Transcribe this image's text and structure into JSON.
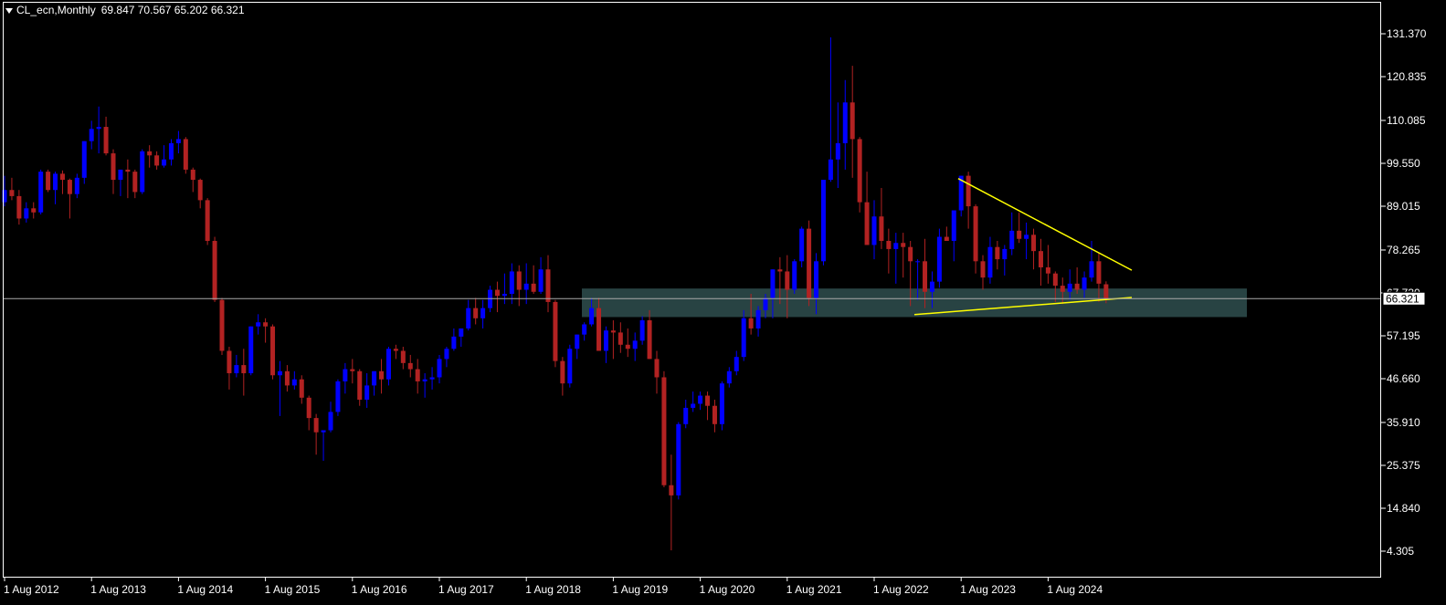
{
  "header": {
    "symbol": "CL_ecn,Monthly",
    "ohlc": "69.847 70.567 65.202 66.321"
  },
  "colors": {
    "background": "#000000",
    "axis": "#ffffff",
    "bull": "#0000ff",
    "bear": "#b22222",
    "wick": "#a0a0a0",
    "zone": "#2f4f4f",
    "trendline": "#ffff00",
    "price_line": "#a9a9a9"
  },
  "chart_data": {
    "type": "candlestick",
    "x_ticks": [
      "1 Aug 2012",
      "1 Aug 2013",
      "1 Aug 2014",
      "1 Aug 2015",
      "1 Aug 2016",
      "1 Aug 2017",
      "1 Aug 2018",
      "1 Aug 2019",
      "1 Aug 2020",
      "1 Aug 2021",
      "1 Aug 2022",
      "1 Aug 2023",
      "1 Aug 2024"
    ],
    "y_ticks": [
      "131.370",
      "120.835",
      "110.085",
      "99.550",
      "89.015",
      "78.265",
      "67.730",
      "57.195",
      "46.660",
      "35.910",
      "25.375",
      "14.840",
      "4.305"
    ],
    "ylim": [
      0.5,
      137.6
    ],
    "current_price": "66.321",
    "start": "2012-02",
    "months_per_x_tick": 12,
    "candles": [
      [
        92.7,
        100.5,
        89.0,
        96.0
      ],
      [
        96.0,
        96.5,
        86.5,
        88.2
      ],
      [
        88.2,
        92.0,
        84.5,
        90.5
      ],
      [
        90.5,
        91.2,
        85.0,
        86.3
      ],
      [
        86.3,
        87.0,
        80.5,
        82.5
      ],
      [
        82.5,
        91.0,
        81.5,
        90.0
      ],
      [
        90.0,
        96.5,
        89.0,
        93.0
      ],
      [
        93.0,
        96.0,
        90.5,
        91.5
      ],
      [
        91.5,
        93.0,
        84.5,
        86.0
      ],
      [
        86.0,
        90.0,
        85.0,
        88.5
      ],
      [
        88.5,
        90.0,
        86.0,
        87.5
      ],
      [
        87.5,
        98.0,
        87.0,
        97.5
      ],
      [
        97.5,
        98.0,
        92.5,
        93.0
      ],
      [
        93.0,
        97.5,
        89.5,
        97.0
      ],
      [
        97.0,
        97.8,
        92.0,
        95.5
      ],
      [
        95.5,
        95.8,
        86.0,
        92.0
      ],
      [
        92.0,
        97.0,
        91.0,
        96.0
      ],
      [
        96.0,
        103.5,
        94.5,
        105.0
      ],
      [
        105.0,
        110.0,
        103.0,
        108.0
      ],
      [
        108.0,
        113.5,
        102.0,
        108.5
      ],
      [
        108.5,
        111.0,
        101.5,
        102.0
      ],
      [
        102.0,
        103.0,
        92.0,
        95.5
      ],
      [
        95.5,
        98.0,
        91.5,
        98.0
      ],
      [
        98.0,
        100.5,
        91.0,
        97.5
      ],
      [
        97.5,
        98.0,
        91.0,
        92.5
      ],
      [
        92.5,
        103.0,
        92.0,
        102.5
      ],
      [
        102.5,
        104.0,
        98.5,
        101.5
      ],
      [
        101.5,
        102.5,
        98.0,
        99.0
      ],
      [
        99.0,
        104.0,
        98.5,
        100.5
      ],
      [
        100.5,
        105.5,
        99.0,
        104.5
      ],
      [
        104.5,
        107.5,
        102.0,
        105.5
      ],
      [
        105.5,
        106.0,
        97.0,
        98.0
      ],
      [
        98.0,
        98.5,
        92.5,
        95.5
      ],
      [
        95.5,
        95.8,
        88.5,
        90.5
      ],
      [
        90.5,
        91.0,
        79.5,
        80.5
      ],
      [
        80.5,
        81.5,
        65.5,
        66.0
      ],
      [
        66.0,
        66.5,
        52.5,
        53.5
      ],
      [
        53.5,
        54.5,
        44.0,
        48.0
      ],
      [
        48.0,
        52.5,
        47.0,
        50.0
      ],
      [
        50.0,
        54.0,
        42.5,
        48.0
      ],
      [
        48.0,
        59.5,
        47.5,
        59.5
      ],
      [
        59.5,
        62.5,
        57.5,
        60.5
      ],
      [
        60.5,
        61.5,
        55.5,
        59.5
      ],
      [
        59.5,
        60.0,
        46.5,
        47.5
      ],
      [
        47.5,
        51.0,
        37.5,
        48.5
      ],
      [
        48.5,
        50.0,
        43.5,
        45.0
      ],
      [
        45.0,
        48.5,
        44.0,
        46.5
      ],
      [
        46.5,
        47.5,
        40.5,
        42.0
      ],
      [
        42.0,
        42.5,
        34.0,
        37.0
      ],
      [
        37.0,
        38.0,
        28.0,
        33.5
      ],
      [
        33.5,
        34.0,
        26.5,
        34.0
      ],
      [
        34.0,
        41.0,
        33.5,
        38.5
      ],
      [
        38.5,
        46.5,
        37.5,
        46.0
      ],
      [
        46.0,
        50.5,
        43.0,
        49.0
      ],
      [
        49.0,
        51.5,
        45.5,
        48.5
      ],
      [
        48.5,
        49.0,
        40.0,
        41.5
      ],
      [
        41.5,
        48.0,
        39.5,
        45.0
      ],
      [
        45.0,
        48.5,
        42.5,
        48.5
      ],
      [
        48.5,
        51.5,
        43.0,
        46.5
      ],
      [
        46.5,
        54.5,
        45.0,
        54.0
      ],
      [
        54.0,
        55.0,
        51.5,
        53.5
      ],
      [
        53.5,
        54.5,
        49.0,
        50.5
      ],
      [
        50.5,
        52.5,
        47.0,
        49.0
      ],
      [
        49.0,
        51.5,
        43.0,
        46.0
      ],
      [
        46.0,
        48.0,
        42.0,
        46.5
      ],
      [
        46.5,
        49.5,
        44.0,
        47.0
      ],
      [
        47.0,
        52.5,
        45.5,
        51.5
      ],
      [
        51.5,
        54.5,
        49.5,
        54.0
      ],
      [
        54.0,
        59.0,
        53.5,
        57.0
      ],
      [
        57.0,
        59.0,
        54.5,
        59.0
      ],
      [
        59.0,
        66.0,
        58.5,
        64.0
      ],
      [
        64.0,
        66.5,
        60.0,
        61.5
      ],
      [
        61.5,
        66.0,
        59.0,
        64.0
      ],
      [
        64.0,
        69.5,
        63.0,
        68.5
      ],
      [
        68.5,
        70.5,
        63.0,
        67.0
      ],
      [
        67.0,
        72.5,
        65.0,
        67.5
      ],
      [
        67.5,
        75.0,
        65.0,
        73.0
      ],
      [
        73.0,
        74.5,
        64.5,
        68.5
      ],
      [
        68.5,
        75.0,
        65.0,
        70.0
      ],
      [
        70.0,
        74.5,
        67.5,
        68.0
      ],
      [
        68.0,
        76.5,
        67.5,
        73.5
      ],
      [
        73.5,
        77.0,
        63.0,
        65.5
      ],
      [
        65.5,
        66.0,
        49.5,
        51.0
      ],
      [
        51.0,
        52.0,
        42.5,
        45.5
      ],
      [
        45.5,
        55.0,
        44.5,
        54.0
      ],
      [
        54.0,
        57.5,
        51.5,
        57.5
      ],
      [
        57.5,
        60.5,
        56.0,
        60.0
      ],
      [
        60.0,
        66.5,
        59.5,
        64.0
      ],
      [
        64.0,
        66.5,
        56.0,
        53.5
      ],
      [
        53.5,
        59.5,
        50.5,
        58.5
      ],
      [
        58.5,
        61.0,
        51.5,
        58.0
      ],
      [
        58.0,
        60.5,
        53.0,
        55.0
      ],
      [
        55.0,
        59.0,
        52.0,
        54.0
      ],
      [
        54.0,
        58.0,
        51.0,
        56.0
      ],
      [
        56.0,
        62.0,
        55.0,
        61.0
      ],
      [
        61.0,
        63.5,
        57.0,
        51.5
      ],
      [
        51.5,
        53.5,
        43.0,
        47.0
      ],
      [
        47.0,
        48.5,
        20.0,
        20.5
      ],
      [
        20.5,
        28.0,
        4.5,
        18.0
      ],
      [
        18.0,
        36.0,
        17.0,
        35.5
      ],
      [
        35.5,
        41.5,
        34.5,
        39.5
      ],
      [
        39.5,
        43.5,
        38.5,
        40.5
      ],
      [
        40.5,
        43.5,
        39.0,
        42.5
      ],
      [
        42.5,
        43.5,
        36.5,
        40.0
      ],
      [
        40.0,
        41.5,
        33.5,
        35.5
      ],
      [
        35.5,
        46.0,
        34.0,
        45.5
      ],
      [
        45.5,
        49.5,
        44.5,
        48.5
      ],
      [
        48.5,
        53.5,
        47.5,
        52.0
      ],
      [
        52.0,
        63.5,
        51.0,
        61.5
      ],
      [
        61.5,
        67.5,
        57.5,
        59.0
      ],
      [
        59.0,
        64.5,
        57.0,
        63.5
      ],
      [
        63.5,
        67.5,
        61.5,
        66.5
      ],
      [
        66.5,
        70.5,
        61.5,
        73.5
      ],
      [
        73.5,
        76.5,
        65.0,
        73.0
      ],
      [
        73.0,
        77.0,
        61.5,
        68.5
      ],
      [
        68.5,
        76.0,
        67.5,
        75.5
      ],
      [
        75.5,
        84.0,
        74.0,
        83.5
      ],
      [
        83.5,
        85.5,
        64.5,
        66.5
      ],
      [
        66.5,
        77.5,
        62.5,
        75.5
      ],
      [
        75.5,
        91.5,
        74.5,
        95.5
      ],
      [
        95.5,
        130.5,
        95.0,
        100.5
      ],
      [
        100.5,
        114.5,
        93.5,
        104.5
      ],
      [
        104.5,
        120.0,
        98.0,
        114.5
      ],
      [
        114.5,
        123.5,
        96.0,
        105.5
      ],
      [
        105.5,
        106.0,
        87.5,
        90.0
      ],
      [
        90.0,
        97.5,
        81.5,
        79.5
      ],
      [
        79.5,
        90.5,
        76.0,
        86.5
      ],
      [
        86.5,
        93.5,
        78.5,
        80.5
      ],
      [
        80.5,
        83.5,
        72.5,
        78.5
      ],
      [
        78.5,
        82.5,
        70.0,
        80.0
      ],
      [
        80.0,
        82.5,
        71.5,
        79.0
      ],
      [
        79.0,
        80.5,
        64.5,
        75.5
      ],
      [
        75.5,
        76.0,
        66.0,
        75.5
      ],
      [
        75.5,
        81.0,
        64.0,
        68.0
      ],
      [
        68.0,
        73.0,
        64.0,
        70.5
      ],
      [
        70.5,
        83.5,
        69.0,
        81.5
      ],
      [
        81.5,
        84.0,
        80.5,
        80.5
      ],
      [
        80.5,
        84.5,
        75.5,
        88.0
      ],
      [
        88.0,
        95.0,
        86.5,
        96.5
      ],
      [
        96.5,
        97.5,
        83.5,
        89.0
      ],
      [
        89.0,
        89.5,
        72.5,
        75.5
      ],
      [
        75.5,
        77.0,
        68.5,
        71.5
      ],
      [
        71.5,
        81.5,
        70.0,
        79.0
      ],
      [
        79.0,
        80.5,
        73.5,
        76.0
      ],
      [
        76.0,
        79.5,
        72.0,
        78.5
      ],
      [
        78.5,
        87.5,
        77.0,
        83.0
      ],
      [
        83.0,
        87.5,
        80.0,
        81.0
      ],
      [
        81.0,
        85.0,
        76.0,
        82.0
      ],
      [
        82.0,
        83.5,
        73.5,
        78.0
      ],
      [
        78.0,
        81.0,
        69.5,
        74.0
      ],
      [
        74.0,
        79.5,
        70.0,
        72.5
      ],
      [
        72.5,
        73.0,
        65.5,
        69.5
      ],
      [
        69.5,
        71.5,
        65.0,
        68.0
      ],
      [
        68.0,
        73.5,
        66.0,
        70.0
      ],
      [
        70.0,
        74.0,
        67.5,
        68.5
      ],
      [
        68.5,
        73.0,
        66.5,
        71.5
      ],
      [
        71.5,
        80.5,
        70.5,
        75.5
      ],
      [
        75.5,
        77.5,
        65.5,
        70.0
      ],
      [
        69.847,
        70.567,
        65.202,
        66.321
      ]
    ]
  }
}
